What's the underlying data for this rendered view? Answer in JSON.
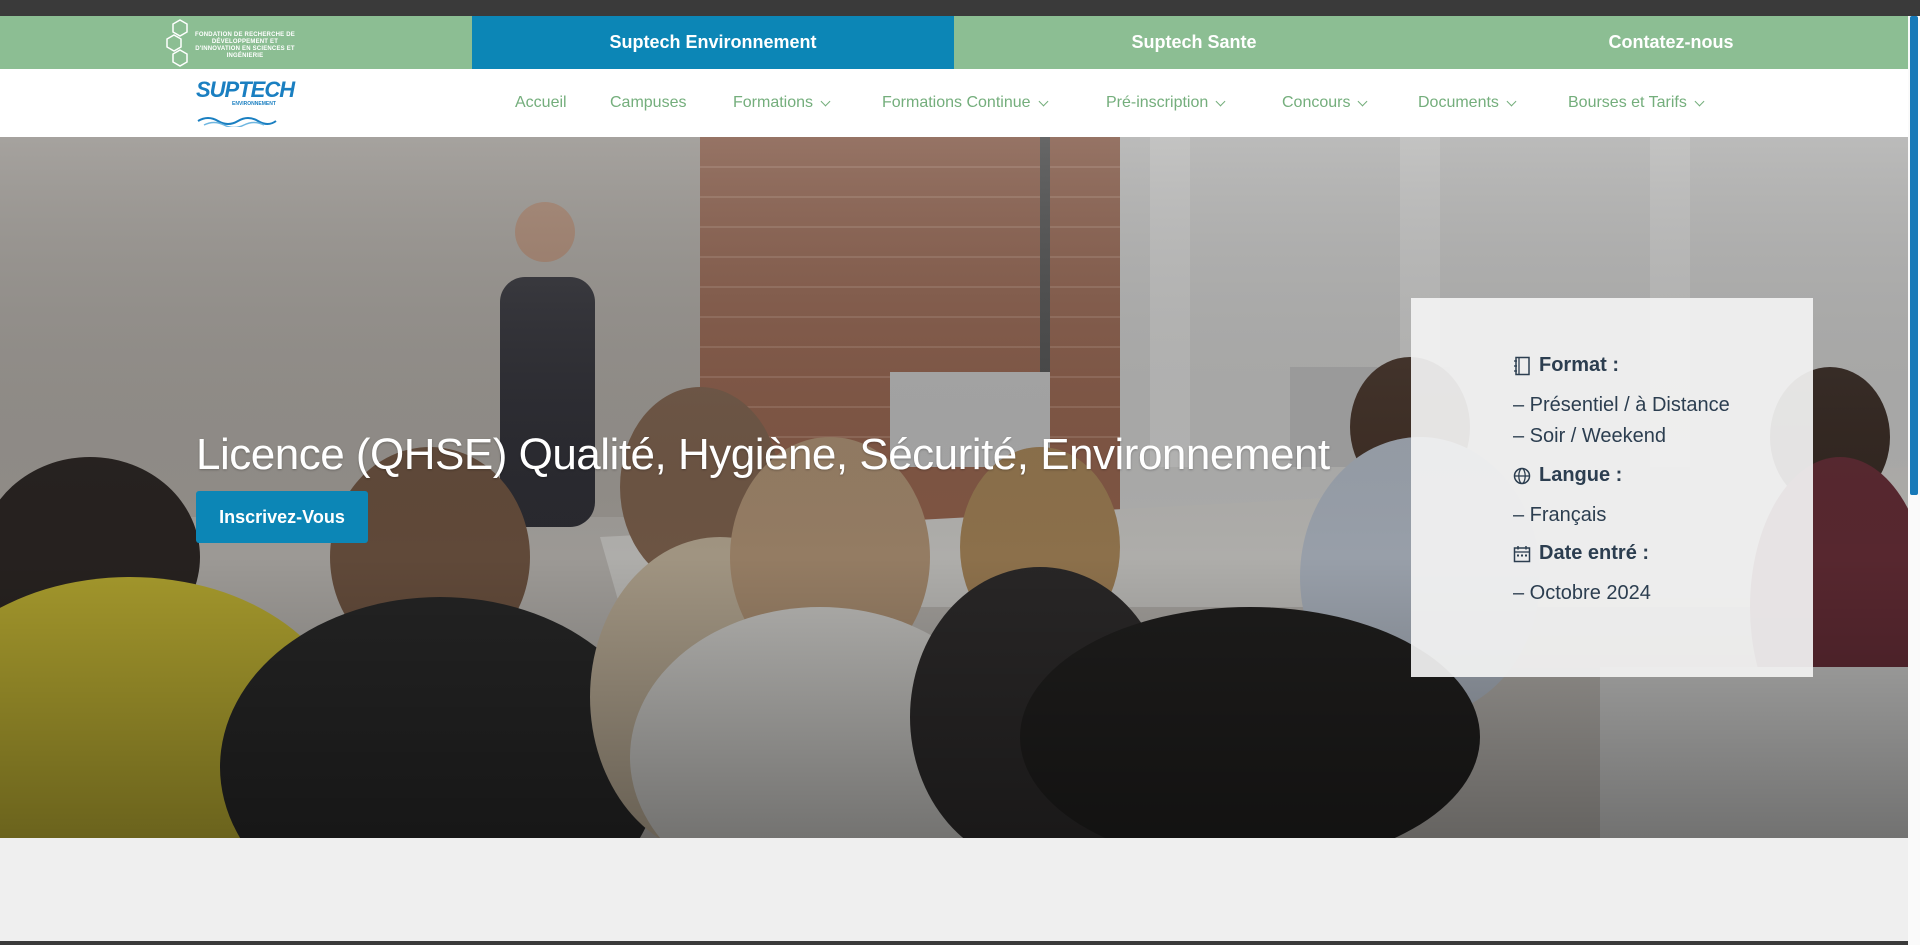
{
  "topbar": {
    "foundation_text": "FONDATION DE RECHERCHE DE DÉVELOPPEMENT ET D'INNOVATION EN SCIENCES ET INGÉNIERIE",
    "tabs": [
      {
        "label": "Suptech Environnement",
        "active": true
      },
      {
        "label": "Suptech Sante",
        "active": false
      },
      {
        "label": "Contatez-nous",
        "active": false
      }
    ]
  },
  "brand": {
    "word": "SUPTECH",
    "sub": "ENVIRONNEMENT"
  },
  "nav": {
    "items": [
      {
        "label": "Accueil",
        "has_dropdown": false
      },
      {
        "label": "Campuses",
        "has_dropdown": false
      },
      {
        "label": "Formations",
        "has_dropdown": true
      },
      {
        "label": "Formations Continue",
        "has_dropdown": true
      },
      {
        "label": "Pré-inscription",
        "has_dropdown": true
      },
      {
        "label": "Concours",
        "has_dropdown": true
      },
      {
        "label": "Documents",
        "has_dropdown": true
      },
      {
        "label": "Bourses et Tarifs",
        "has_dropdown": true
      }
    ]
  },
  "hero": {
    "title": "Licence (QHSE) Qualité, Hygiène, Sécurité, Environnement",
    "cta_label": "Inscrivez-Vous"
  },
  "info_card": {
    "format_label": "Format :",
    "format_lines": [
      "– Présentiel / à Distance",
      "– Soir / Weekend"
    ],
    "langue_label": "Langue :",
    "langue_lines": [
      "– Français"
    ],
    "date_label": "Date entré :",
    "date_lines": [
      "– Octobre 2024"
    ]
  },
  "colors": {
    "topbar_green": "#8cbe93",
    "accent_blue": "#0c86b6",
    "nav_green": "#74ae7c",
    "card_text": "#2c3e50"
  },
  "icons": {
    "format": "notebook-icon",
    "langue": "globe-icon",
    "date": "calendar-icon"
  }
}
